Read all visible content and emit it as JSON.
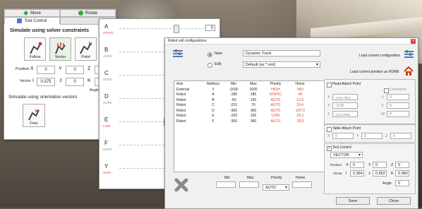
{
  "left_panel": {
    "tabs_top": [
      {
        "label": "Move",
        "icon_color": "#3aa53a"
      },
      {
        "label": "Rotate",
        "icon_color": "#3aa53a"
      }
    ],
    "tabs_second": [
      {
        "label": "Tool Control",
        "active": true
      },
      {
        "label": "",
        "active": false
      }
    ],
    "heading_solver": "Simulate using solver constraints",
    "solver_buttons": [
      "Follow",
      "Vector",
      "Point"
    ],
    "position_label": "Position",
    "position": [
      {
        "axis": "X",
        "value": "0"
      },
      {
        "axis": "Y",
        "value": "0"
      },
      {
        "axis": "Z",
        "value": ""
      }
    ],
    "vector_label": "Vector",
    "vector": [
      {
        "axis": "I",
        "value": "0.375"
      },
      {
        "axis": "J",
        "value": "0"
      },
      {
        "axis": "K",
        "value": ""
      }
    ],
    "angle_label": "Angle",
    "heading_orientation": "Simulate using orientation vectors",
    "free_button": "Free"
  },
  "slider_panel": {
    "sliders": [
      {
        "axis": "A",
        "sub": "STATIC",
        "sub_red": true,
        "value": "0",
        "thumb": 0.67
      },
      {
        "axis": "B",
        "sub": "AUTO",
        "sub_red": false,
        "value": "",
        "thumb": 0.6
      },
      {
        "axis": "C",
        "sub": "AUTO",
        "sub_red": false,
        "value": "",
        "thumb": 0.6
      },
      {
        "axis": "D",
        "sub": "AUTO",
        "sub_red": false,
        "value": "",
        "thumb": 0.6
      },
      {
        "axis": "E",
        "sub": "LOW",
        "sub_red": true,
        "value": "",
        "thumb": 0.55
      },
      {
        "axis": "F",
        "sub": "AUTO",
        "sub_red": false,
        "value": "",
        "thumb": 0.6
      },
      {
        "axis": "Y",
        "sub": "HIGH",
        "sub_red": true,
        "value": "",
        "thumb": 0.6
      }
    ]
  },
  "dialog": {
    "title": "Robot cell configurations",
    "close": "×",
    "new_label": "New",
    "edit_label": "Edit",
    "name_value": "Dynamic Track",
    "config_select": "Default (as *.xml)",
    "load_current_config": "Load current configuration",
    "load_home": "Load current position as HOME",
    "headers": [
      "Axis",
      "Address",
      "Min",
      "Max",
      "Priority",
      "Home"
    ],
    "rows": [
      [
        "External",
        "Y",
        "-1600",
        "1600",
        "HIGH",
        "-960"
      ],
      [
        "Robot",
        "A",
        "-185",
        "185",
        "STATIC",
        "-45"
      ],
      [
        "Robot",
        "B",
        "-50",
        "100",
        "AUTO",
        "12.9"
      ],
      [
        "Robot",
        "C",
        "-215",
        "70",
        "AUTO",
        "19.4"
      ],
      [
        "Robot",
        "D",
        "-360",
        "360",
        "AUTO",
        "-237.0"
      ],
      [
        "Robot",
        "E",
        "-100",
        "100",
        "LOW",
        "-59.1"
      ],
      [
        "Robot",
        "F",
        "-360",
        "360",
        "AUTO",
        "-28.5"
      ]
    ],
    "bottom_min": "Min",
    "bottom_max": "Max",
    "bottom_priority": "Priority",
    "bottom_home": "Home",
    "bottom_priority_value": "AUTO",
    "head_attach": "Head Attach Point",
    "orientation": "Orientation",
    "head_x": "1218.7904",
    "head_y": "-3.95",
    "head_z": "1234.0966",
    "head_u": "0",
    "head_v": "0",
    "head_w": "0",
    "table_attach": "Table Attach Point",
    "table_x": "0",
    "table_y": "0",
    "table_z": "0",
    "tool_control": "Tool Control",
    "tool_select": "VECTOR",
    "tc_position": "Position",
    "tc_x": "0",
    "tc_y": "0",
    "tc_z": "0",
    "tc_vector": "Vector",
    "tc_i": "0.364",
    "tc_j": "0.852",
    "tc_k": "0.980",
    "tc_angle_label": "Angle",
    "tc_angle": "0",
    "save_label": "Save",
    "close_label": "Close"
  }
}
